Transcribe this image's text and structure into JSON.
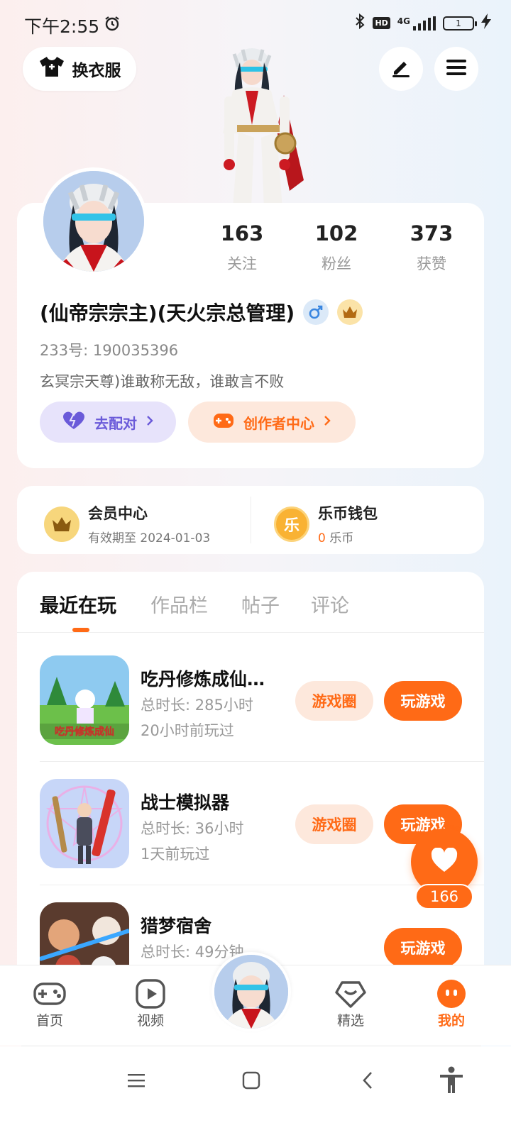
{
  "status_bar": {
    "time": "下午2:55",
    "network": "4G",
    "hd": "HD",
    "battery": "1"
  },
  "top_actions": {
    "outfit_label": "换衣服"
  },
  "profile": {
    "stats": [
      {
        "value": "163",
        "label": "关注"
      },
      {
        "value": "102",
        "label": "粉丝"
      },
      {
        "value": "373",
        "label": "获赞"
      }
    ],
    "nickname": "(仙帝宗宗主)(天火宗总管理)",
    "id_line": "233号: 190035396",
    "bio": "玄冥宗天尊)谁敢称无敌，谁敢言不败",
    "match_label": "去配对",
    "creator_label": "创作者中心"
  },
  "membership": {
    "vip_title": "会员中心",
    "vip_sub": "有效期至 2024-01-03",
    "wallet_title": "乐币钱包",
    "wallet_amount": "0",
    "wallet_unit": " 乐币",
    "wallet_icon_char": "乐"
  },
  "tabs": [
    "最近在玩",
    "作品栏",
    "帖子",
    "评论"
  ],
  "games": [
    {
      "name": "吃丹修炼成仙…",
      "duration": "总时长: 285小时",
      "last_played": "20小时前玩过",
      "community": "游戏圈",
      "play": "玩游戏",
      "thumb_text": "吃丹修炼成仙"
    },
    {
      "name": "战士模拟器",
      "duration": "总时长: 36小时",
      "last_played": "1天前玩过",
      "community": "游戏圈",
      "play": "玩游戏"
    },
    {
      "name": "猎梦宿舍",
      "duration": "总时长: 49分钟",
      "play": "玩游戏"
    }
  ],
  "like": {
    "count": "166"
  },
  "bottom_nav": [
    {
      "label": "首页"
    },
    {
      "label": "视频"
    },
    {
      "label": "精选"
    },
    {
      "label": "我的"
    }
  ],
  "colors": {
    "accent": "#ff6a16",
    "purple": "#6a5ad9"
  }
}
